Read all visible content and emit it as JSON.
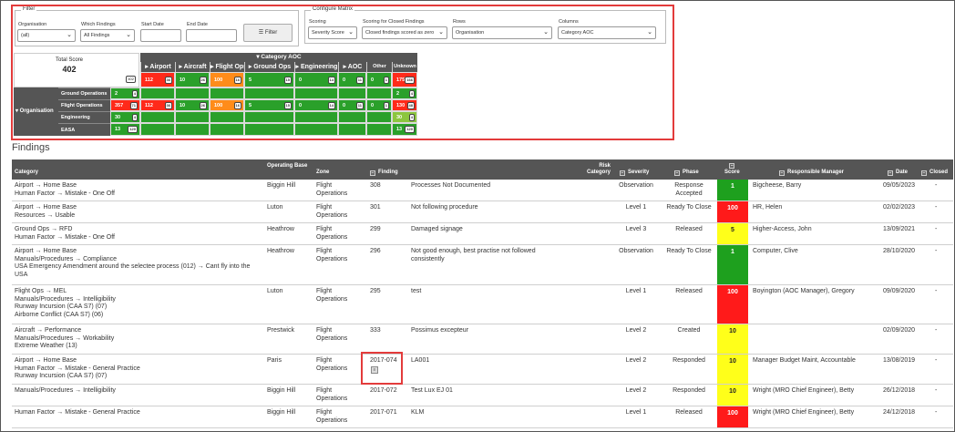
{
  "filter": {
    "legend": "Filter",
    "organisation": {
      "label": "Organisation",
      "value": "(all)"
    },
    "which_findings": {
      "label": "Which Findings",
      "value": "All Findings"
    },
    "start_date": {
      "label": "Start Date",
      "value": ""
    },
    "end_date": {
      "label": "End Date",
      "value": ""
    },
    "button": "Filter"
  },
  "configure": {
    "legend": "Configure Matrix",
    "scoring": {
      "label": "Scoring",
      "value": "Severity Score"
    },
    "closed_scoring": {
      "label": "Scoring for Closed Findings",
      "value": "Closed findings scored as zero"
    },
    "rows": {
      "label": "Rows",
      "value": "Organisation"
    },
    "columns": {
      "label": "Columns",
      "value": "Category AOC"
    }
  },
  "matrix": {
    "total_label": "Total Score",
    "total_value": "402",
    "total_badge": "402",
    "category_title": "▾ Category AOC",
    "row_group": "▾ Organisation",
    "columns": [
      "▸ Airport",
      "▸ Aircraft",
      "▸ Flight Ops",
      "▸ Ground Ops",
      "▸ Engineering",
      "▸ AOC",
      "Other",
      "Unknown"
    ],
    "col_totals": [
      {
        "v": "112",
        "b": "36",
        "c": "#ff2a1a"
      },
      {
        "v": "10",
        "b": "26",
        "c": "#2aa02a"
      },
      {
        "v": "100",
        "b": "16",
        "c": "#ff8c1a"
      },
      {
        "v": "5",
        "b": "15",
        "c": "#2aa02a"
      },
      {
        "v": "0",
        "b": "14",
        "c": "#2aa02a"
      },
      {
        "v": "0",
        "b": "11",
        "c": "#2aa02a"
      },
      {
        "v": "0",
        "b": "1",
        "c": "#2aa02a"
      },
      {
        "v": "175",
        "b": "166",
        "c": "#ff2a1a"
      }
    ],
    "rows": [
      {
        "label": "Ground Operations",
        "total": "2",
        "tbadge": "4",
        "tcolor": "#2aa02a",
        "cells": [
          null,
          null,
          null,
          null,
          null,
          null,
          null,
          {
            "v": "2",
            "b": "4",
            "c": "#2aa02a"
          }
        ]
      },
      {
        "label": "Flight Operations",
        "total": "357",
        "tbadge": "71",
        "tcolor": "#ff2a1a",
        "cells": [
          {
            "v": "112",
            "b": "36",
            "c": "#ff2a1a"
          },
          {
            "v": "10",
            "b": "26",
            "c": "#2aa02a"
          },
          {
            "v": "100",
            "b": "16",
            "c": "#ff8c1a"
          },
          {
            "v": "5",
            "b": "15",
            "c": "#2aa02a"
          },
          {
            "v": "0",
            "b": "14",
            "c": "#2aa02a"
          },
          {
            "v": "0",
            "b": "11",
            "c": "#2aa02a"
          },
          {
            "v": "0",
            "b": "1",
            "c": "#2aa02a"
          },
          {
            "v": "130",
            "b": "48",
            "c": "#ff2a1a"
          }
        ]
      },
      {
        "label": "Engineering",
        "total": "30",
        "tbadge": "4",
        "tcolor": "#2aa02a",
        "cells": [
          null,
          null,
          null,
          null,
          null,
          null,
          null,
          {
            "v": "30",
            "b": "4",
            "c": "#8cc63f"
          }
        ]
      },
      {
        "label": "EASA",
        "total": "13",
        "tbadge": "120",
        "tcolor": "#2aa02a",
        "cells": [
          null,
          null,
          null,
          null,
          null,
          null,
          null,
          {
            "v": "13",
            "b": "120",
            "c": "#2aa02a"
          }
        ]
      }
    ]
  },
  "findings": {
    "title": "Findings",
    "headers": {
      "category": "Category",
      "base": "Operating Base",
      "zone": "Zone",
      "finding": "Finding",
      "risk": "Risk Category",
      "severity": "Severity",
      "phase": "Phase",
      "score": "Score",
      "manager": "Responsible Manager",
      "date": "Date",
      "closed": "Closed"
    },
    "rows": [
      {
        "category": [
          "Airport → Home Base",
          "Human Factor → Mistake - One Off"
        ],
        "base": "Biggin Hill",
        "zone": "Flight Operations",
        "id": "308",
        "desc": "Processes Not Documented",
        "severity": "Observation",
        "phase": "Response Accepted",
        "score": "1",
        "scolor": "#1ea01e",
        "scolor_text": "#fff",
        "manager": "Bigcheese, Barry",
        "date": "09/05/2023",
        "closed": "-"
      },
      {
        "category": [
          "Airport → Home Base",
          "Resources → Usable"
        ],
        "base": "Luton",
        "zone": "Flight Operations",
        "id": "301",
        "desc": "Not following procedure",
        "severity": "Level 1",
        "phase": "Ready To Close",
        "score": "100",
        "scolor": "#ff1a1a",
        "scolor_text": "#fff",
        "manager": "HR, Helen",
        "date": "02/02/2023",
        "closed": "-"
      },
      {
        "category": [
          "Ground Ops → RFD",
          "Human Factor → Mistake - One Off"
        ],
        "base": "Heathrow",
        "zone": "Flight Operations",
        "id": "299",
        "desc": "Damaged signage",
        "severity": "Level 3",
        "phase": "Released",
        "score": "5",
        "scolor": "#ffff1a",
        "scolor_text": "#222",
        "manager": "Higher-Access, John",
        "date": "13/09/2021",
        "closed": "-"
      },
      {
        "category": [
          "Airport → Home Base",
          "Manuals/Procedures → Compliance",
          "USA Emergency Amendment around the selectee process (012) → Cant fly into the",
          "USA"
        ],
        "base": "Heathrow",
        "zone": "Flight Operations",
        "id": "296",
        "desc": "Not good enough, best practise not followed consistently",
        "severity": "Observation",
        "phase": "Ready To Close",
        "score": "1",
        "scolor": "#1ea01e",
        "scolor_text": "#fff",
        "manager": "Computer, Clive",
        "date": "28/10/2020",
        "closed": "-"
      },
      {
        "category": [
          "Flight Ops → MEL",
          "Manuals/Procedures → Intelligibility",
          "Runway Incursion (CAA S7) (07)",
          "Airborne Conflict (CAA S7) (06)"
        ],
        "base": "Luton",
        "zone": "Flight Operations",
        "id": "295",
        "desc": "test",
        "severity": "Level 1",
        "phase": "Released",
        "score": "100",
        "scolor": "#ff1a1a",
        "scolor_text": "#fff",
        "manager": "Boyington (AOC Manager), Gregory",
        "date": "09/09/2020",
        "closed": "-"
      },
      {
        "category": [
          "Aircraft → Performance",
          "Manuals/Procedures → Workability",
          "Extreme Weather (13)"
        ],
        "base": "Prestwick",
        "zone": "Flight Operations",
        "id": "333",
        "desc": "Possimus excepteur",
        "severity": "Level 2",
        "phase": "Created",
        "score": "10",
        "scolor": "#ffff1a",
        "scolor_text": "#222",
        "manager": "",
        "date": "02/09/2020",
        "closed": "-"
      },
      {
        "category": [
          "Airport → Home Base",
          "Human Factor → Mistake - General Practice",
          "Runway Incursion (CAA S7) (07)"
        ],
        "base": "Paris",
        "zone": "Flight Operations",
        "id": "2017-074",
        "desc": "LA001",
        "severity": "Level 2",
        "phase": "Responded",
        "score": "10",
        "scolor": "#ffff1a",
        "scolor_text": "#222",
        "manager": "Manager Budget Maint, Accountable",
        "date": "13/08/2019",
        "closed": "-"
      },
      {
        "category": [
          "Manuals/Procedures → Intelligibility"
        ],
        "base": "Biggin Hill",
        "zone": "Flight Operations",
        "id": "2017-072",
        "desc": "Test Lux EJ 01",
        "severity": "Level 2",
        "phase": "Responded",
        "score": "10",
        "scolor": "#ffff1a",
        "scolor_text": "#222",
        "manager": "Wright (MRO Chief Engineer), Betty",
        "date": "26/12/2018",
        "closed": "-"
      },
      {
        "category": [
          "Human Factor → Mistake - General Practice"
        ],
        "base": "Biggin Hill",
        "zone": "Flight Operations",
        "id": "2017-071",
        "desc": "KLM",
        "severity": "Level 1",
        "phase": "Released",
        "score": "100",
        "scolor": "#ff1a1a",
        "scolor_text": "#fff",
        "manager": "Wright (MRO Chief Engineer), Betty",
        "date": "24/12/2018",
        "closed": "-"
      }
    ]
  }
}
